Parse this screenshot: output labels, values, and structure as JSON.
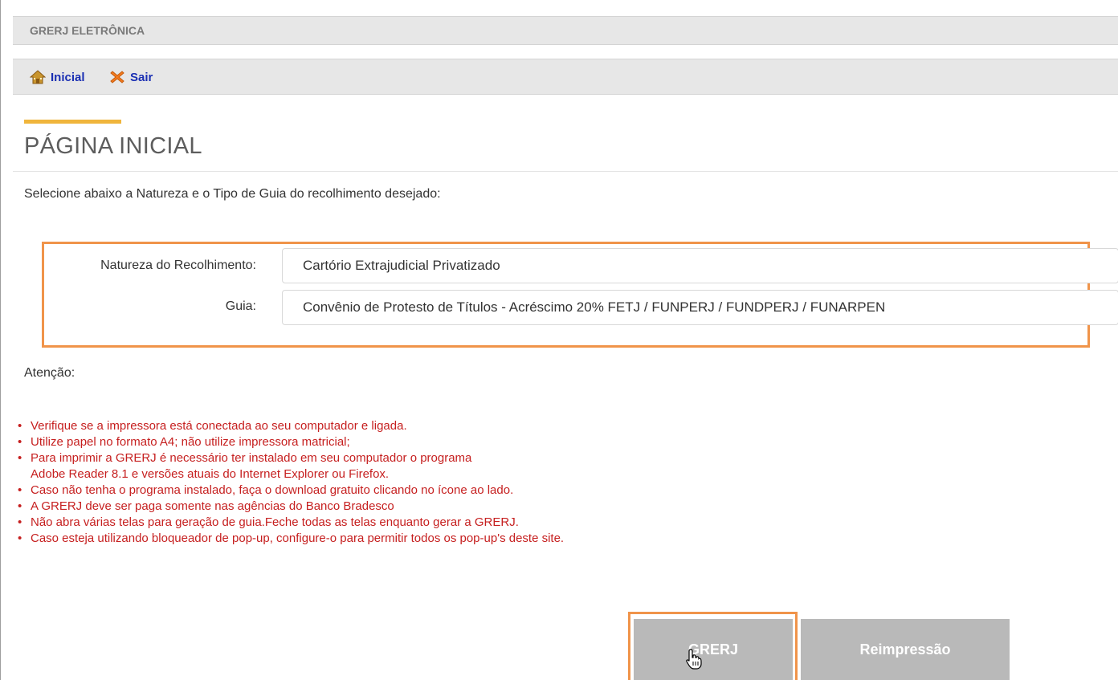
{
  "header": {
    "title": "GRERJ ELETRÔNICA"
  },
  "nav": {
    "home_label": "Inicial",
    "exit_label": "Sair"
  },
  "page": {
    "title": "PÁGINA INICIAL",
    "instruction": "Selecione abaixo a Natureza e o Tipo de Guia do recolhimento desejado:"
  },
  "form": {
    "natureza_label": "Natureza do Recolhimento:",
    "natureza_value": "Cartório Extrajudicial Privatizado",
    "guia_label": "Guia:",
    "guia_value": "Convênio de Protesto de Títulos - Acréscimo 20% FETJ / FUNPERJ / FUNDPERJ / FUNARPEN"
  },
  "attention": {
    "title": "Atenção:",
    "items": [
      "Verifique se a impressora está conectada ao seu computador e ligada.",
      "Utilize papel no formato A4; não utilize impressora matricial;",
      "Para imprimir a GRERJ é necessário ter instalado em seu computador o programa",
      "Adobe Reader 8.1 e versões atuais do Internet Explorer ou Firefox.",
      "Caso não tenha o programa instalado, faça o download gratuito clicando no ícone ao lado.",
      "A GRERJ deve ser paga somente nas agências do Banco Bradesco",
      "Não abra várias telas para geração de guia.Feche todas as telas enquanto gerar a GRERJ.",
      "Caso esteja utilizando bloqueador de pop-up, configure-o para permitir todos os pop-up's deste site."
    ]
  },
  "buttons": {
    "grerj_label": "GRERJ",
    "reimpressao_label": "Reimpressão"
  },
  "icons": {
    "home": "home-icon",
    "exit": "close-x-icon",
    "cursor": "hand-pointer-icon"
  },
  "colors": {
    "highlight": "#f0944a",
    "accent": "#f0b53c",
    "link": "#1a2fb3",
    "warning_text": "#c62020",
    "button_bg": "#b9b9b9"
  }
}
